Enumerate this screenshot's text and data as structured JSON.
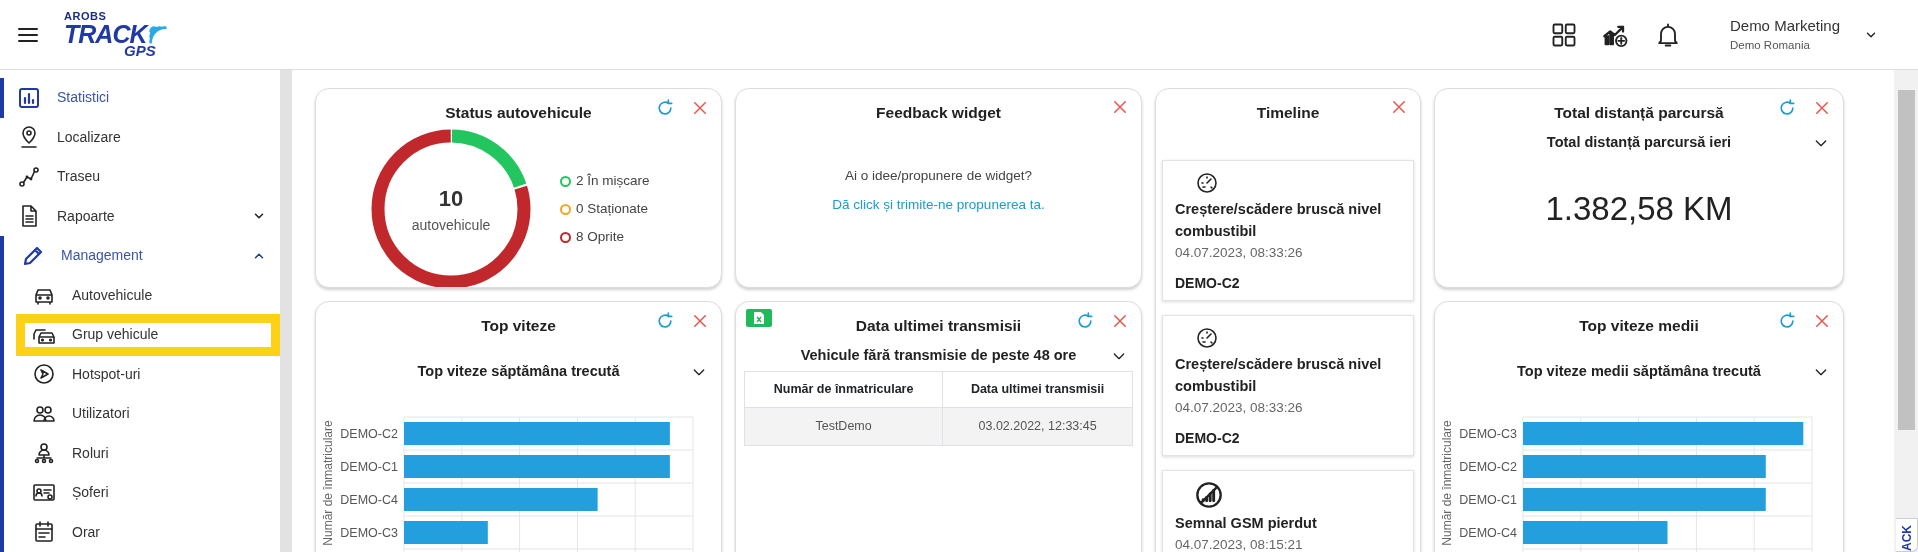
{
  "logo": {
    "top": "AROBS",
    "main": "TRACK",
    "sub": "GPS"
  },
  "user": {
    "name": "Demo Marketing",
    "company": "Demo Romania"
  },
  "sidebar": {
    "items": [
      {
        "label": "Statistici",
        "selected": true,
        "highlighted": false
      },
      {
        "label": "Localizare",
        "selected": false,
        "highlighted": false
      },
      {
        "label": "Traseu",
        "selected": false,
        "highlighted": false
      },
      {
        "label": "Rapoarte",
        "selected": false,
        "highlighted": false,
        "expanded": false
      },
      {
        "label": "Management",
        "selected": true,
        "highlighted": false,
        "expanded": true,
        "children": [
          {
            "label": "Autovehicule",
            "selected": false,
            "highlighted": false
          },
          {
            "label": "Grup vehicule",
            "selected": false,
            "highlighted": true
          },
          {
            "label": "Hotspot-uri",
            "selected": false,
            "highlighted": false
          },
          {
            "label": "Utilizatori",
            "selected": false,
            "highlighted": false
          },
          {
            "label": "Roluri",
            "selected": false,
            "highlighted": false
          },
          {
            "label": "Șoferi",
            "selected": false,
            "highlighted": false
          },
          {
            "label": "Orar",
            "selected": false,
            "highlighted": false
          }
        ]
      }
    ]
  },
  "widgets": [
    {
      "kind": "status",
      "title": "Status autovehicule",
      "refreshable": true,
      "total": "10",
      "total_label": "autovehicule",
      "legend": [
        {
          "count": "2",
          "label": "În mișcare",
          "color": "#22c55e"
        },
        {
          "count": "0",
          "label": "Staționate",
          "color": "#f5a623"
        },
        {
          "count": "8",
          "label": "Oprite",
          "color": "#c0282b"
        }
      ]
    },
    {
      "kind": "feedback",
      "title": "Feedback widget",
      "refreshable": false,
      "question": "Ai o idee/propunere de widget?",
      "link": "Dă click și trimite-ne propunerea ta."
    },
    {
      "kind": "timeline",
      "title": "Timeline",
      "refreshable": false,
      "events": [
        {
          "kind": "fuel",
          "title": "Creștere/scădere bruscă nivel combustibil",
          "time": "04.07.2023, 08:33:26",
          "vehicle": "DEMO-C2"
        },
        {
          "kind": "fuel",
          "title": "Creștere/scădere bruscă nivel combustibil",
          "time": "04.07.2023, 08:33:26",
          "vehicle": "DEMO-C2"
        },
        {
          "kind": "signal",
          "title": "Semnal GSM pierdut",
          "time": "04.07.2023, 08:15:21"
        }
      ]
    },
    {
      "kind": "total",
      "title": "Total distanță parcursă",
      "refreshable": true,
      "period": "Total distanță parcursă ieri",
      "value": "1.382,58 KM"
    },
    {
      "kind": "bars",
      "title": "Top viteze",
      "refreshable": true,
      "period": "Top viteze săptămâna trecută",
      "axis_title": "Număr de înmatriculare",
      "bar_labels": [
        "DEMO-C2",
        "DEMO-C1",
        "DEMO-C4",
        "DEMO-C3"
      ]
    },
    {
      "kind": "table",
      "title": "Data ultimei transmisii",
      "refreshable": true,
      "export": true,
      "period": "Vehicule fără transmisie de peste 48 ore",
      "columns": [
        "Număr de înmatriculare",
        "Data ultimei transmisii"
      ],
      "rows": [
        [
          "TestDemo",
          "03.02.2022, 12:33:45"
        ]
      ]
    },
    {
      "kind": "bars",
      "title": "Top viteze medii",
      "refreshable": true,
      "period": "Top viteze medii săptămâna trecută",
      "axis_title": "Număr de înmatriculare",
      "bar_labels": [
        "DEMO-C3",
        "DEMO-C2",
        "DEMO-C1",
        "DEMO-C4"
      ]
    }
  ],
  "feedback_tab": "ACK"
}
